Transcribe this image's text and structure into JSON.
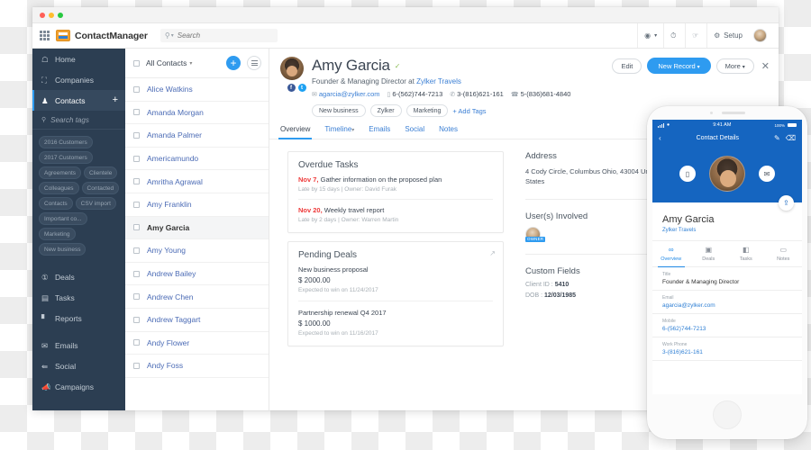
{
  "window": {
    "traffic_lights": [
      "close",
      "minimize",
      "maximize"
    ]
  },
  "topbar": {
    "apps_icon": "grid-apps-icon",
    "brand": "ContactManager",
    "search": {
      "placeholder": "Search",
      "value": "",
      "icon": "search-icon"
    },
    "right_items": [
      {
        "name": "globe-icon",
        "label": "",
        "glyph": "◔"
      },
      {
        "name": "history-icon",
        "label": "",
        "glyph": "◴"
      },
      {
        "name": "notifications-icon",
        "label": "",
        "glyph": "♟"
      },
      {
        "name": "setup-gear",
        "label": "Setup",
        "glyph": "⚙"
      }
    ],
    "avatar": "user-avatar"
  },
  "sidebar": {
    "items": [
      {
        "label": "Home",
        "icon": "home-icon",
        "active": false
      },
      {
        "label": "Companies",
        "icon": "building-icon",
        "active": false
      },
      {
        "label": "Contacts",
        "icon": "person-icon",
        "active": true,
        "add": "+"
      }
    ],
    "tag_search": {
      "placeholder": "Search tags",
      "icon": "search-icon"
    },
    "tags": [
      "2016 Customers",
      "2017 Customers",
      "Agreements",
      "Clientele",
      "Colleagues",
      "Contacted",
      "Contacts",
      "CSV import",
      "Important co...",
      "Marketing",
      "New business"
    ],
    "items2": [
      {
        "label": "Deals",
        "icon": "dollar-icon"
      },
      {
        "label": "Tasks",
        "icon": "checklist-icon"
      },
      {
        "label": "Reports",
        "icon": "chart-icon"
      }
    ],
    "items3": [
      {
        "label": "Emails",
        "icon": "envelope-icon"
      },
      {
        "label": "Social",
        "icon": "share-icon"
      },
      {
        "label": "Campaigns",
        "icon": "megaphone-icon"
      }
    ]
  },
  "contact_list": {
    "header": {
      "label": "All Contacts",
      "caret": "▾",
      "add_button": "+",
      "menu_button": "list-menu"
    },
    "rows": [
      {
        "name": "Alice Watkins",
        "selected": false
      },
      {
        "name": "Amanda Morgan",
        "selected": false
      },
      {
        "name": "Amanda Palmer",
        "selected": false
      },
      {
        "name": "Americamundo",
        "selected": false
      },
      {
        "name": "Amritha Agrawal",
        "selected": false
      },
      {
        "name": "Amy Franklin",
        "selected": false
      },
      {
        "name": "Amy Garcia",
        "selected": true
      },
      {
        "name": "Amy Young",
        "selected": false
      },
      {
        "name": "Andrew Bailey",
        "selected": false
      },
      {
        "name": "Andrew Chen",
        "selected": false
      },
      {
        "name": "Andrew Taggart",
        "selected": false
      },
      {
        "name": "Andy Flower",
        "selected": false
      },
      {
        "name": "Andy Foss",
        "selected": false
      }
    ]
  },
  "detail": {
    "name": "Amy Garcia",
    "verified_icon": "verified-check-icon",
    "title_prefix": "Founder & Managing Director at",
    "company": "Zylker Travels",
    "email": "agarcia@zylker.com",
    "mobile": "6-(562)744-7213",
    "work_phone": "3-(816)621-161",
    "home_phone": "5-(836)681-4840",
    "tags": [
      "New business",
      "Zylker",
      "Marketing"
    ],
    "add_tags": "+ Add Tags",
    "actions": {
      "edit": "Edit",
      "new_record": "New Record",
      "more": "More",
      "close": "close-icon"
    },
    "tabs": [
      {
        "label": "Overview",
        "active": true,
        "caret": ""
      },
      {
        "label": "Timeline",
        "active": false,
        "caret": "▾"
      },
      {
        "label": "Emails",
        "active": false,
        "caret": ""
      },
      {
        "label": "Social",
        "active": false,
        "caret": ""
      },
      {
        "label": "Notes",
        "active": false,
        "caret": ""
      }
    ],
    "overdue_tasks": {
      "title": "Overdue Tasks",
      "items": [
        {
          "date": "Nov 7,",
          "text": "Gather information on the proposed plan",
          "sub": "Late by 15 days | Owner: David Furak"
        },
        {
          "date": "Nov 20,",
          "text": "Weekly travel report",
          "sub": "Late by 2 days | Owner: Warren Martin"
        }
      ]
    },
    "pending_deals": {
      "title": "Pending Deals",
      "expand_icon": "expand-icon",
      "items": [
        {
          "name": "New business proposal",
          "amount": "$ 2000.00",
          "sub": "Expected to win on 11/24/2017"
        },
        {
          "name": "Partnership renewal Q4 2017",
          "amount": "$ 1000.00",
          "sub": "Expected to win on 11/16/2017"
        }
      ]
    },
    "address": {
      "title": "Address",
      "line": "4 Cody Circle, Columbus Ohio, 43004 United States"
    },
    "users_involved": {
      "title": "User(s) Involved",
      "badge": "OWNER"
    },
    "custom_fields": {
      "title": "Custom Fields",
      "rows": [
        {
          "label": "Client ID :",
          "value": "5410"
        },
        {
          "label": "DOB :",
          "value": "12/03/1985"
        }
      ]
    }
  },
  "phone": {
    "status": {
      "time": "9:41 AM",
      "battery": "100%",
      "signal_icon": "signal-bars-icon",
      "wifi_icon": "wifi-icon"
    },
    "app_bar": {
      "back": "back-arrow-icon",
      "title": "Contact Details",
      "edit": "pencil-icon",
      "delete": "trash-icon"
    },
    "hero": {
      "call_icon": "phone-icon",
      "message_icon": "message-icon",
      "share_icon": "share-icon",
      "avatar": "contact-avatar"
    },
    "name": "Amy Garcia",
    "company": "Zylker Travels",
    "tabs": [
      {
        "label": "Overview",
        "icon": "overview-icon",
        "glyph": "∞",
        "active": true
      },
      {
        "label": "Deals",
        "icon": "deals-icon",
        "glyph": "▣",
        "active": false
      },
      {
        "label": "Tasks",
        "icon": "tasks-icon",
        "glyph": "☐",
        "active": false
      },
      {
        "label": "Notes",
        "icon": "notes-icon",
        "glyph": "▭",
        "active": false
      }
    ],
    "fields": [
      {
        "label": "Title",
        "value": "Founder & Managing Director",
        "link": false
      },
      {
        "label": "Email",
        "value": "agarcia@zylker.com",
        "link": true
      },
      {
        "label": "Mobile",
        "value": "6-(562)744-7213",
        "link": true
      },
      {
        "label": "Work Phone",
        "value": "3-(816)621-161",
        "link": true
      }
    ],
    "home_button": "home-button"
  },
  "colors": {
    "sidebar": "#2c3e52",
    "accent_blue": "#2e9bf0",
    "phone_blue": "#1565c0",
    "link_blue": "#3b7fd4",
    "overdue_red": "#ee3b3b"
  }
}
